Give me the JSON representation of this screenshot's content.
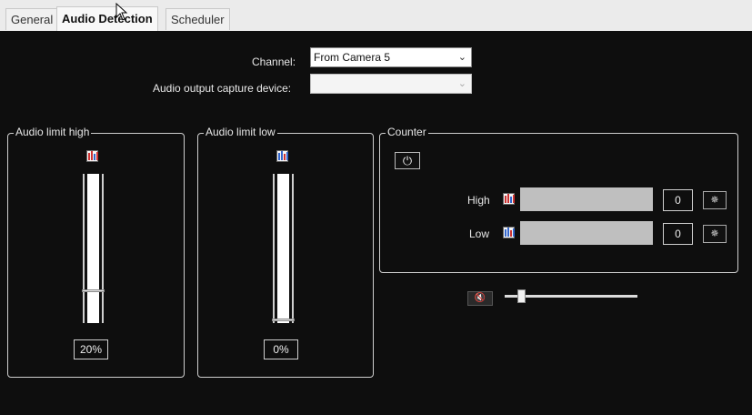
{
  "tabs": [
    "General",
    "Audio Detection",
    "Scheduler"
  ],
  "channel": {
    "label": "Channel:",
    "value": "From Camera 5"
  },
  "capture_device": {
    "label": "Audio output capture device:",
    "value": ""
  },
  "audio_limit_high": {
    "title": "Audio limit high",
    "percent_label": "20%",
    "level": 0.2
  },
  "audio_limit_low": {
    "title": "Audio limit low",
    "percent_label": "0%",
    "level": 0.0
  },
  "counter": {
    "title": "Counter",
    "high": {
      "label": "High",
      "value": "0"
    },
    "low": {
      "label": "Low",
      "value": "0"
    }
  },
  "volume": {
    "level": 0.1
  }
}
